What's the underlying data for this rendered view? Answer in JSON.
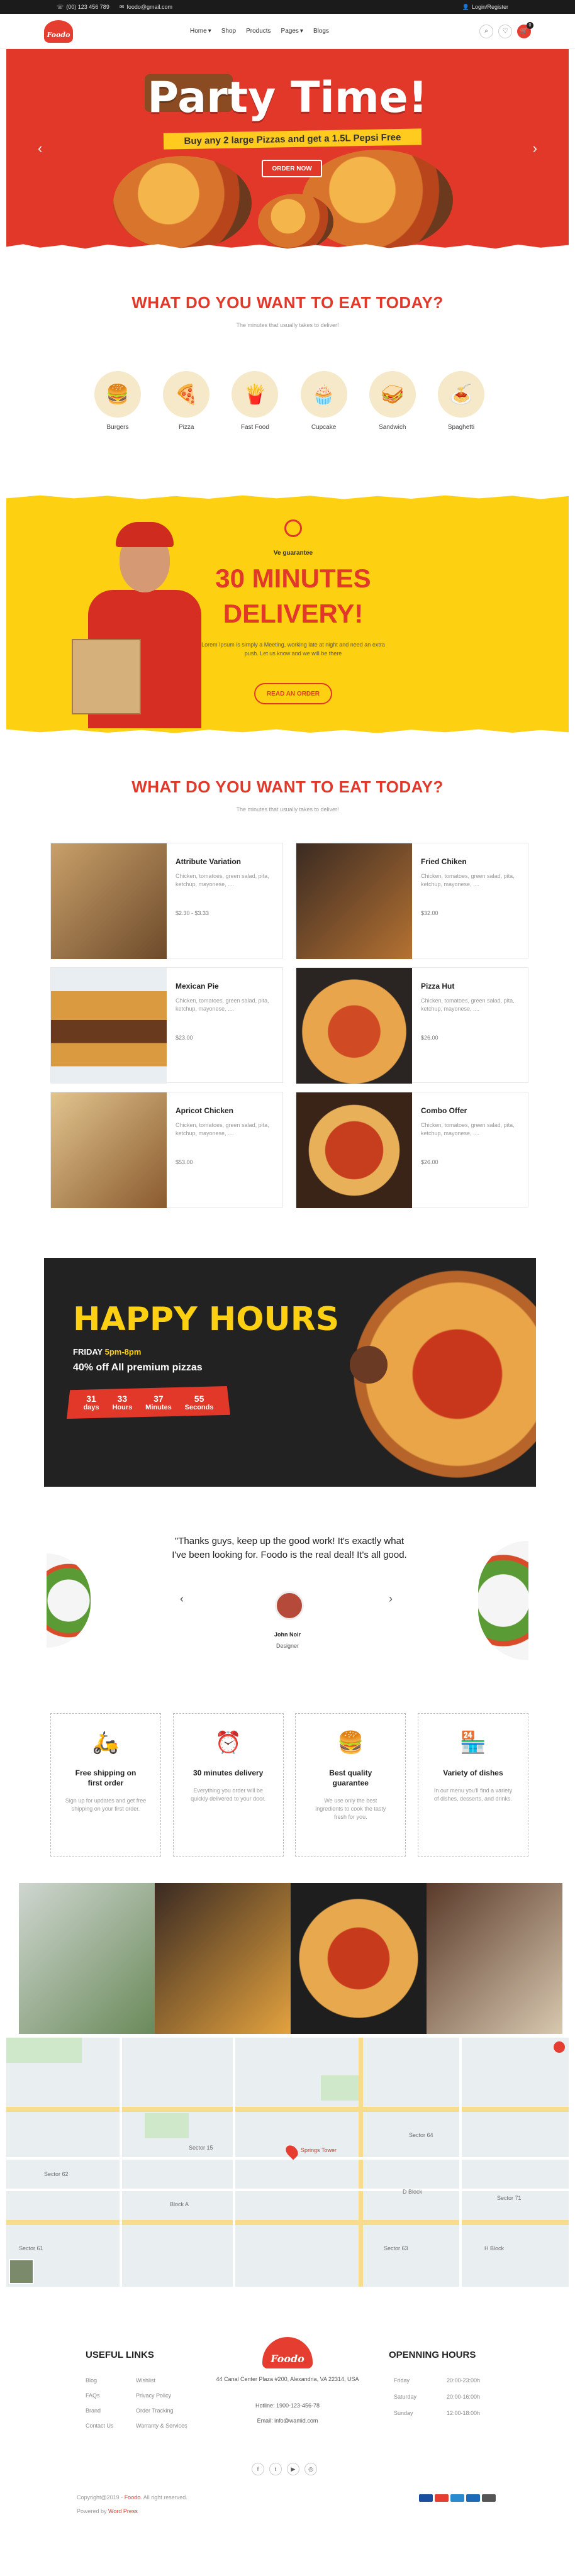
{
  "topbar": {
    "phone": "(00) 123 456 789",
    "email": "foodo@gmail.com",
    "login": "Login/Register"
  },
  "header": {
    "logo": "Foodo",
    "nav": [
      "Home",
      "Shop",
      "Products",
      "Pages",
      "Blogs"
    ],
    "cart_count": "0"
  },
  "hero": {
    "title": "Party Time!",
    "subtitle": "Buy any 2 large Pizzas and get a 1.5L Pepsi Free",
    "button": "ORDER NOW"
  },
  "categories_section": {
    "title": "WHAT DO YOU WANT TO EAT TODAY?",
    "subtitle": "The minutes that usually takes to deliver!",
    "items": [
      {
        "label": "Burgers",
        "icon": "🍔"
      },
      {
        "label": "Pizza",
        "icon": "🍕"
      },
      {
        "label": "Fast Food",
        "icon": "🍟"
      },
      {
        "label": "Cupcake",
        "icon": "🧁"
      },
      {
        "label": "Sandwich",
        "icon": "🥪"
      },
      {
        "label": "Spaghetti",
        "icon": "🍝"
      }
    ]
  },
  "delivery": {
    "guarantee": "Ve guarantee",
    "headline": "30 MINUTES DELIVERY!",
    "text": "Lorem Ipsum is simply a Meeting, working late at night and need an extra push. Let us know and we will be there",
    "button": "READ AN ORDER"
  },
  "menu_section": {
    "title": "WHAT DO YOU WANT TO EAT TODAY?",
    "subtitle": "The minutes that usually takes to deliver!",
    "items": [
      {
        "name": "Attribute Variation",
        "desc": "Chicken, tomatoes, green salad, pita, ketchup, mayonese, ....",
        "price": "$2.30 - $3.33"
      },
      {
        "name": "Fried Chiken",
        "desc": "Chicken, tomatoes, green salad, pita, ketchup, mayonese, ....",
        "price": "$32.00"
      },
      {
        "name": "Mexican Pie",
        "desc": "Chicken, tomatoes, green salad, pita, ketchup, mayonese, ....",
        "price": "$23.00"
      },
      {
        "name": "Pizza Hut",
        "desc": "Chicken, tomatoes, green salad, pita, ketchup, mayonese, ....",
        "price": "$26.00"
      },
      {
        "name": "Apricot Chicken",
        "desc": "Chicken, tomatoes, green salad, pita, ketchup, mayonese, ....",
        "price": "$53.00"
      },
      {
        "name": "Combo Offer",
        "desc": "Chicken, tomatoes, green salad, pita, ketchup, mayonese, ....",
        "price": "$26.00"
      }
    ]
  },
  "happy_hours": {
    "title": "HAPPY HOURS",
    "day": "FRIDAY",
    "time": "5pm-8pm",
    "offer": "40% off All premium pizzas",
    "countdown": [
      {
        "value": "31",
        "unit": "days"
      },
      {
        "value": "33",
        "unit": "Hours"
      },
      {
        "value": "37",
        "unit": "Minutes"
      },
      {
        "value": "55",
        "unit": "Seconds"
      }
    ]
  },
  "testimonial": {
    "quote": "\"Thanks guys, keep up the good work! It's exactly what I've been looking for. Foodo is the real deal! It's all good.",
    "name": "John Noir",
    "role": "Designer"
  },
  "features": [
    {
      "title": "Free shipping on first order",
      "desc": "Sign up for updates and get free shipping on your first order.",
      "icon": "🛵"
    },
    {
      "title": "30 minutes delivery",
      "desc": "Everything you order will be quickly delivered to your door.",
      "icon": "⏰"
    },
    {
      "title": "Best quality guarantee",
      "desc": "We use only the best ingredients to cook the tasty fresh for you.",
      "icon": "🍔"
    },
    {
      "title": "Variety of dishes",
      "desc": "In our menu you'll find a variety of dishes, desserts, and drinks.",
      "icon": "🏪"
    }
  ],
  "map": {
    "labels": [
      "Sector 62",
      "Sector 63",
      "Sector 61",
      "Sector 71",
      "Block A",
      "D Block",
      "H Block",
      "Sector 64",
      "Sector 15"
    ],
    "pin_label": "Springs Tower"
  },
  "footer": {
    "useful_links_title": "USEFUL LINKS",
    "links_col1": [
      "Blog",
      "FAQs",
      "Brand",
      "Contact Us"
    ],
    "links_col2": [
      "Wishlist",
      "Privacy Policy",
      "Order Tracking",
      "Warranty & Services"
    ],
    "logo": "Foodo",
    "address": "44 Canal Center Plaza #200, Alexandria, VA 22314, USA",
    "hotline": "Hotline: 1900-123-456-78",
    "email": "Email: info@wamid.com",
    "hours_title": "OPENNING HOURS",
    "hours": [
      {
        "day": "Friday",
        "time": "20:00-23:00h"
      },
      {
        "day": "Saturday",
        "time": "20:00-16:00h"
      },
      {
        "day": "Sunday",
        "time": "12:00-18:00h"
      }
    ],
    "copyright_prefix": "Copyright@2019 - ",
    "copyright_brand": "Foodo",
    "copyright_suffix": ". All right reserved.",
    "powered_prefix": "Powered by ",
    "powered_brand": "Word Press"
  }
}
